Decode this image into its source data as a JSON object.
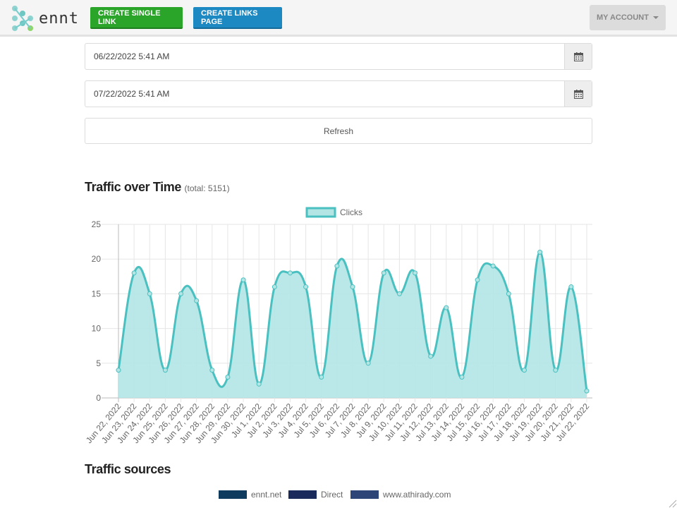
{
  "app": {
    "logo_text": "ennt"
  },
  "navbar": {
    "create_single_link": "CREATE SINGLE LINK",
    "create_links_page": "CREATE LINKS PAGE",
    "my_account": "MY ACCOUNT"
  },
  "filters": {
    "start_date": "06/22/2022 5:41 AM",
    "end_date": "07/22/2022 5:41 AM",
    "refresh_label": "Refresh"
  },
  "traffic_over_time": {
    "title": "Traffic over Time",
    "total_text": "(total: 5151)"
  },
  "traffic_sources": {
    "title": "Traffic sources",
    "legend": [
      {
        "label": "ennt.net",
        "color": "#0e3b5e"
      },
      {
        "label": "Direct",
        "color": "#1a2a5a"
      },
      {
        "label": "www.athirady.com",
        "color": "#2d4577"
      }
    ]
  },
  "chart_data": {
    "type": "area",
    "title": "",
    "xlabel": "",
    "ylabel": "",
    "ylim": [
      0,
      25
    ],
    "yticks": [
      0,
      5,
      10,
      15,
      20,
      25
    ],
    "grid": true,
    "legend": "top-center",
    "categories": [
      "Jun 22, 2022",
      "Jun 23, 2022",
      "Jun 24, 2022",
      "Jun 25, 2022",
      "Jun 26, 2022",
      "Jun 27, 2022",
      "Jun 28, 2022",
      "Jun 29, 2022",
      "Jun 30, 2022",
      "Jul 1, 2022",
      "Jul 2, 2022",
      "Jul 3, 2022",
      "Jul 4, 2022",
      "Jul 5, 2022",
      "Jul 6, 2022",
      "Jul 7, 2022",
      "Jul 8, 2022",
      "Jul 9, 2022",
      "Jul 10, 2022",
      "Jul 11, 2022",
      "Jul 12, 2022",
      "Jul 13, 2022",
      "Jul 14, 2022",
      "Jul 15, 2022",
      "Jul 16, 2022",
      "Jul 17, 2022",
      "Jul 18, 2022",
      "Jul 19, 2022",
      "Jul 20, 2022",
      "Jul 21, 2022",
      "Jul 22, 2022"
    ],
    "series": [
      {
        "name": "Clicks",
        "values": [
          4,
          18,
          15,
          4,
          15,
          14,
          4,
          3,
          17,
          2,
          16,
          18,
          16,
          3,
          19,
          16,
          5,
          18,
          15,
          18,
          6,
          13,
          3,
          17,
          19,
          15,
          4,
          21,
          4,
          16,
          1
        ]
      }
    ],
    "colors": {
      "line": "#4bc0c0",
      "fill": "#b3e5e5"
    }
  }
}
